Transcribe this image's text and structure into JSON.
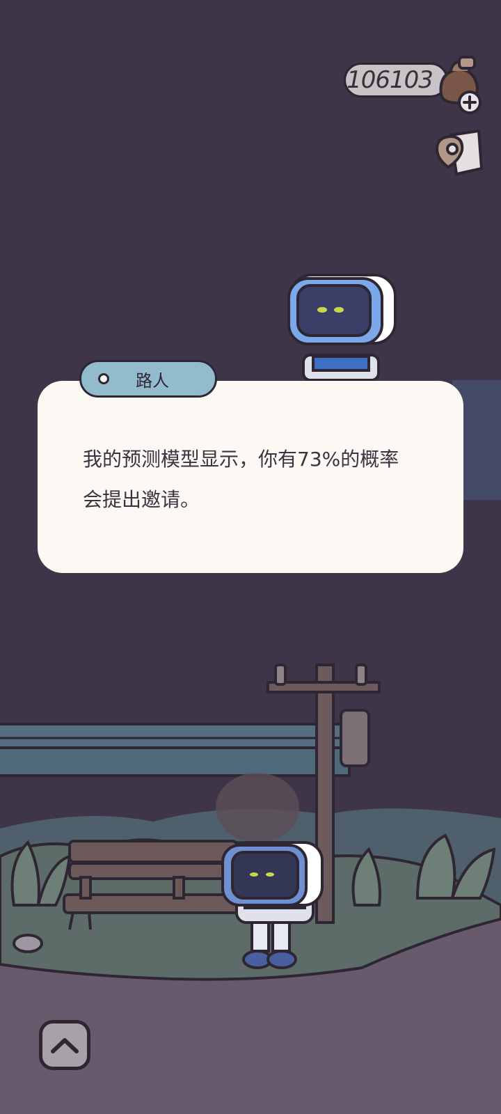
{
  "hud": {
    "currency_amount": "106103",
    "currency_icon": "coin-bag-icon",
    "add_icon": "plus-icon",
    "map_icon": "map-pin-icon"
  },
  "dialog": {
    "speaker": "路人",
    "text": "我的预测模型显示，你有73%的概率会提出邀请。"
  },
  "controls": {
    "expand_icon": "chevron-up-icon"
  },
  "colors": {
    "night_sky": "#3e3549",
    "dialog_bg": "#fcf9f5",
    "speaker_tag": "#92bccd",
    "ground": "#675a6c",
    "grass": "#5b6a63"
  }
}
